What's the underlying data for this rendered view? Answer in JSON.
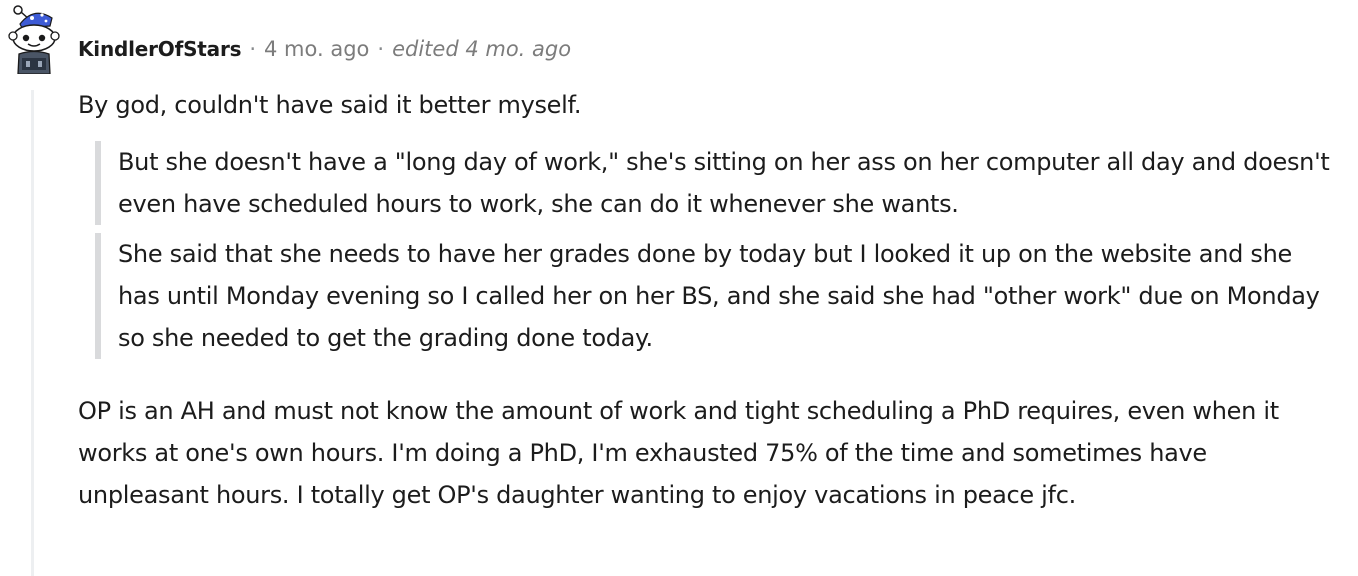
{
  "comment": {
    "author": "KindlerOfStars",
    "separator": "·",
    "age": "4 mo. ago",
    "edited": "edited 4 mo. ago",
    "avatar_icon": "snoo-avatar-icon",
    "paragraph_1": "By god, couldn't have said it better myself.",
    "quotes": [
      "But she doesn't have a \"long day of work,\" she's sitting on her ass on her computer all day and doesn't even have scheduled hours to work, she can do it whenever she wants.",
      "She said that she needs to have her grades done by today but I looked it up on the website and she has until Monday evening so I called her on her BS, and she said she had \"other work\" due on Monday so she needed to get the grading done today."
    ],
    "paragraph_2": "OP is an AH and must not know the amount of work and tight scheduling a PhD requires, even when it works at one's own hours. I'm doing a PhD, I'm exhausted 75% of the time and sometimes have unpleasant hours. I totally get OP's daughter wanting to enjoy vacations in peace jfc."
  },
  "colors": {
    "thread_line": "#edeff1",
    "quote_bar": "#d9dadc",
    "meta_text": "#7c7c7c",
    "body_text": "#1c1c1c"
  }
}
